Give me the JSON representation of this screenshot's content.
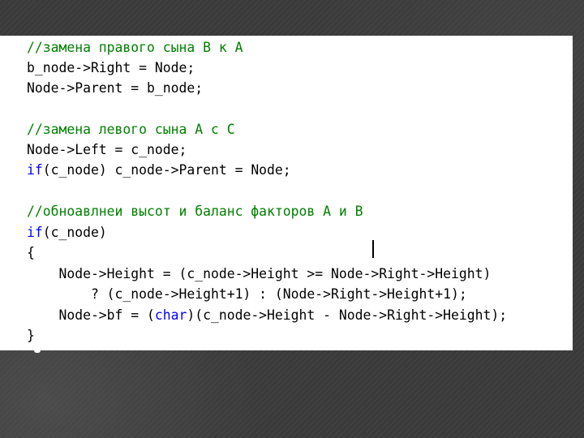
{
  "colors": {
    "background": "#3b3b3b",
    "panel": "#ffffff",
    "code_text": "#000000",
    "comment": "#008000",
    "keyword": "#0000ff"
  },
  "code": {
    "line1": "//замена правого сына B к A",
    "line2": "b_node->Right = Node;",
    "line3": "Node->Parent = b_node;",
    "line5": "//замена левого сына A с C",
    "line6": "Node->Left = c_node;",
    "line7_kw": "if",
    "line7_rest": "(c_node) c_node->Parent = Node;",
    "line9": "//обноавлнеи высот и баланс факторов A и B",
    "line10_kw": "if",
    "line10_rest": "(c_node)",
    "line11": "{",
    "line12": "    Node->Height = (c_node->Height >= Node->Right->Height)",
    "line13": "        ? (c_node->Height+1) : (Node->Right->Height+1);",
    "line14_a": "    Node->bf = (",
    "line14_kw": "char",
    "line14_b": ")(c_node->Height - Node->Right->Height);",
    "line15": "}"
  }
}
